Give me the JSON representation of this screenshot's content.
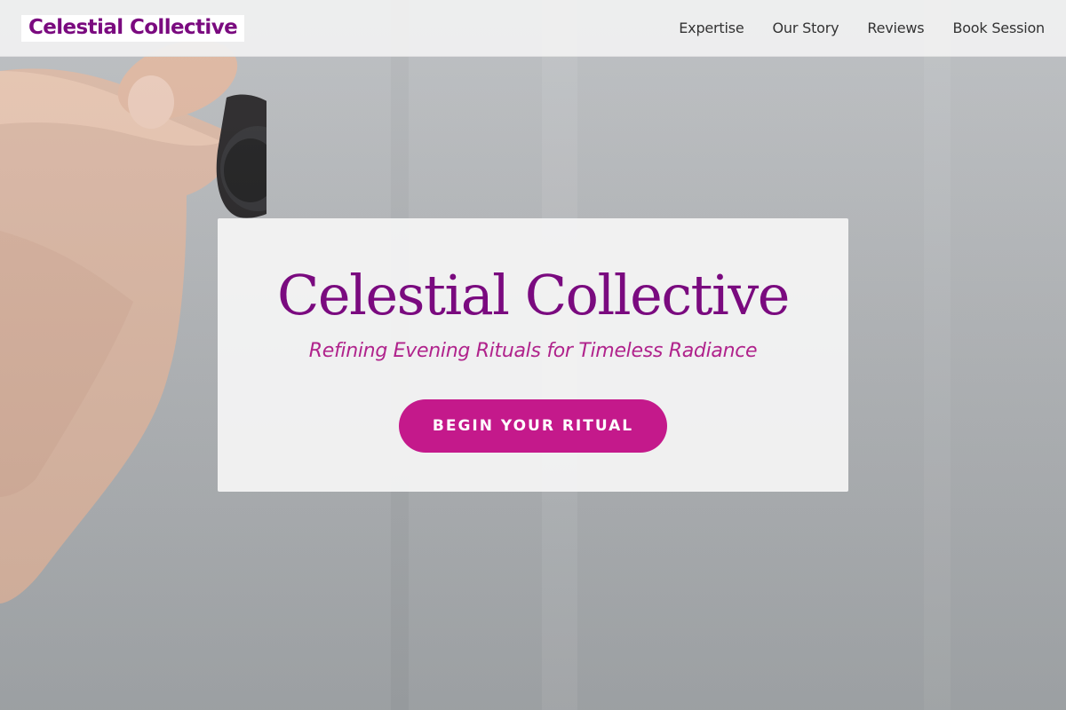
{
  "header": {
    "brand": "Celestial Collective",
    "nav": [
      {
        "label": "Expertise"
      },
      {
        "label": "Our Story"
      },
      {
        "label": "Reviews"
      },
      {
        "label": "Book Session"
      }
    ]
  },
  "hero": {
    "title": "Celestial Collective",
    "tagline": "Refining Evening Rituals for Timeless Radiance",
    "cta_label": "BEGIN YOUR RITUAL",
    "image_icon": "hand-holding-dropper-photo"
  },
  "colors": {
    "brand": "#7a0a7f",
    "accent": "#c4198b",
    "tagline": "#b0238c",
    "nav_text": "#333333"
  }
}
